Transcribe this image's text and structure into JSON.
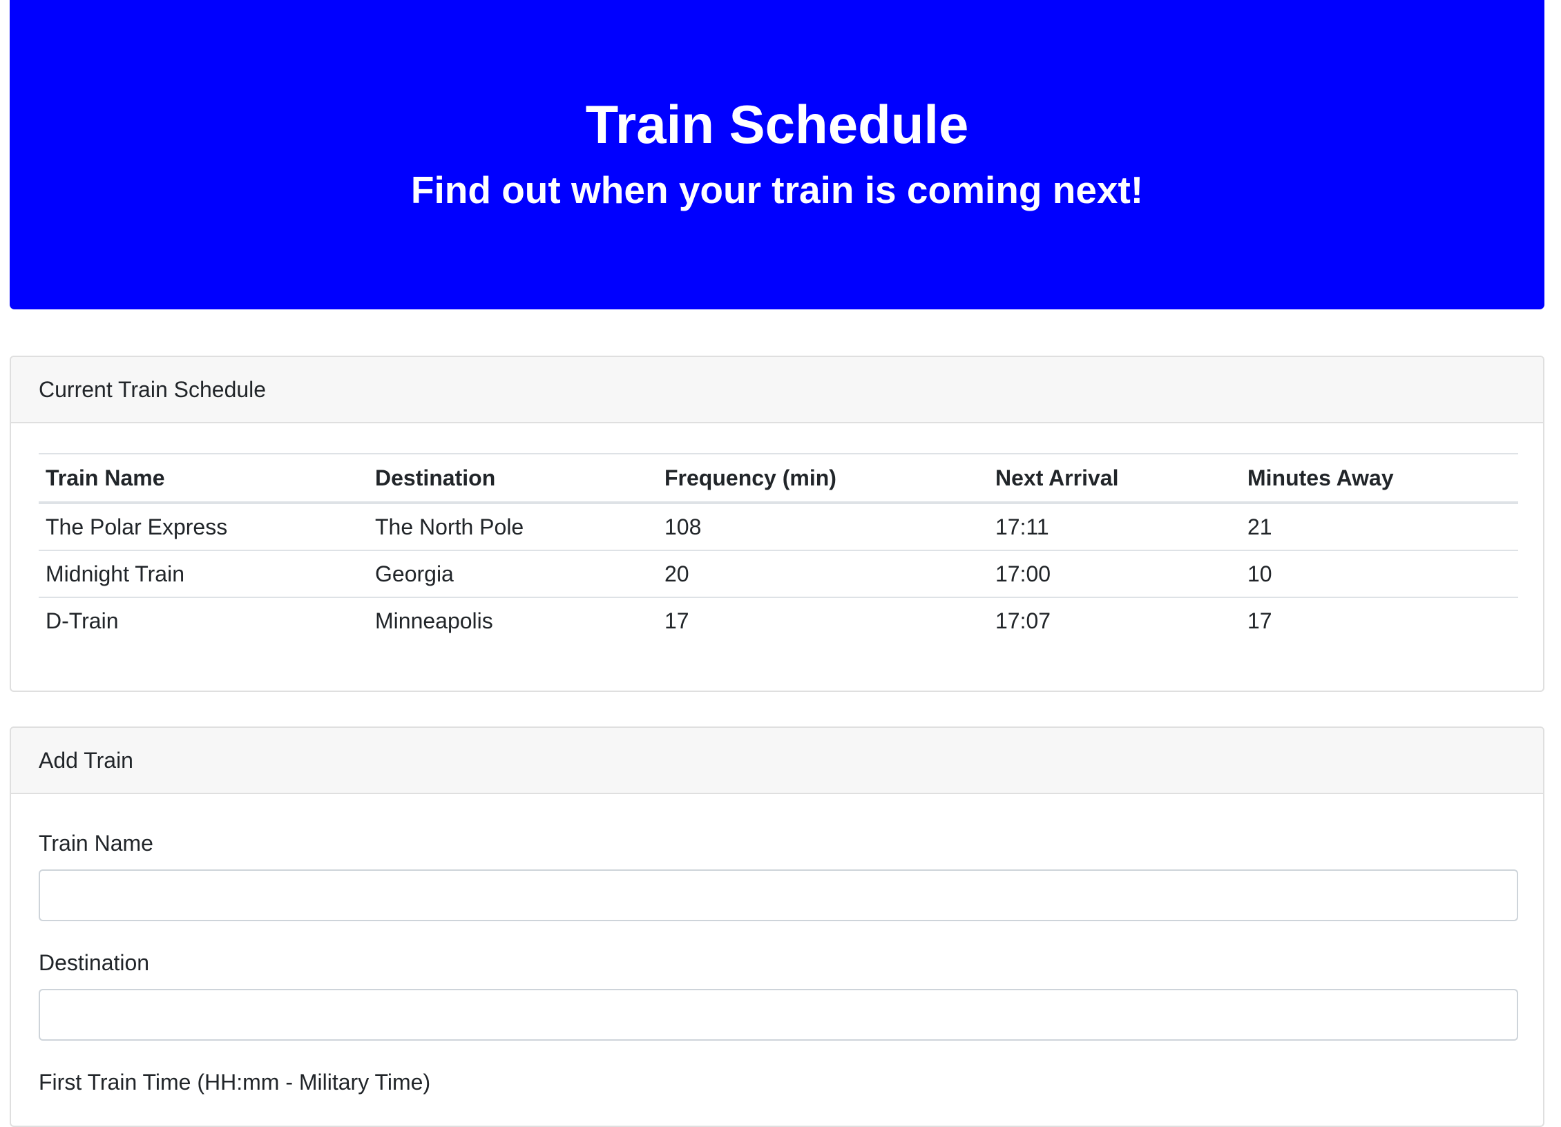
{
  "header": {
    "title": "Train Schedule",
    "subtitle": "Find out when your train is coming next!"
  },
  "schedule": {
    "card_title": "Current Train Schedule",
    "columns": [
      "Train Name",
      "Destination",
      "Frequency (min)",
      "Next Arrival",
      "Minutes Away"
    ],
    "rows": [
      [
        "The Polar Express",
        "The North Pole",
        "108",
        "17:11",
        "21"
      ],
      [
        "Midnight Train",
        "Georgia",
        "20",
        "17:00",
        "10"
      ],
      [
        "D-Train",
        "Minneapolis",
        "17",
        "17:07",
        "17"
      ]
    ]
  },
  "add_train": {
    "card_title": "Add Train",
    "fields": [
      {
        "label": "Train Name",
        "value": ""
      },
      {
        "label": "Destination",
        "value": ""
      },
      {
        "label": "First Train Time (HH:mm - Military Time)",
        "value": ""
      }
    ]
  },
  "colors": {
    "header_background": "#0000ff",
    "header_text": "#ffffff",
    "card_header_background": "#f7f7f7"
  }
}
